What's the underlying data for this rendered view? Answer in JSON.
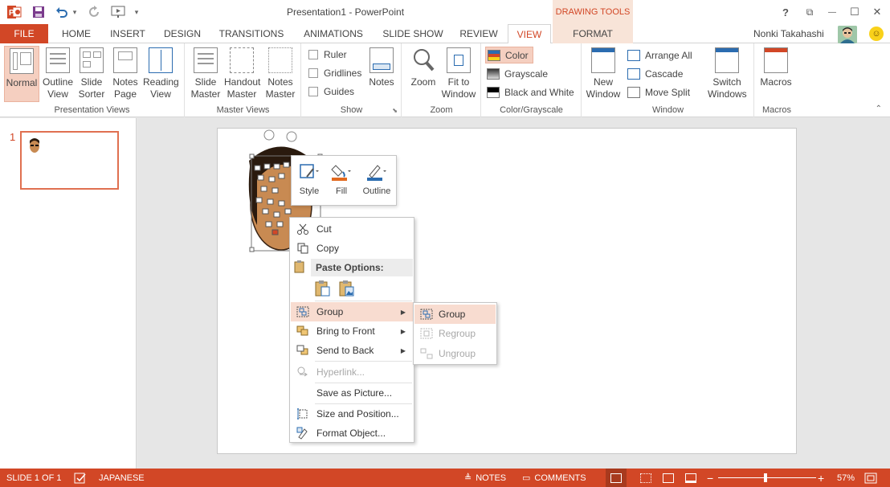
{
  "app": {
    "title": "Presentation1 - PowerPoint",
    "contextual_tab_group": "DRAWING TOOLS"
  },
  "window_controls": {
    "help": "?",
    "restore": "⧉",
    "minimize": "—",
    "maximize": "☐",
    "close": "✕"
  },
  "quick_access": {
    "undo_dropdown": "▾",
    "customize": "▾"
  },
  "tabs": {
    "file": "FILE",
    "home": "HOME",
    "insert": "INSERT",
    "design": "DESIGN",
    "transitions": "TRANSITIONS",
    "animations": "ANIMATIONS",
    "slideshow": "SLIDE SHOW",
    "review": "REVIEW",
    "view": "VIEW",
    "format": "FORMAT"
  },
  "user": {
    "name": "Nonki Takahashi"
  },
  "ribbon": {
    "presentation_views": {
      "label": "Presentation Views",
      "normal": "Normal",
      "outline_view": "Outline\nView",
      "slide_sorter": "Slide\nSorter",
      "notes_page": "Notes\nPage",
      "reading_view": "Reading\nView"
    },
    "master_views": {
      "label": "Master Views",
      "slide_master": "Slide\nMaster",
      "handout_master": "Handout\nMaster",
      "notes_master": "Notes\nMaster"
    },
    "show": {
      "label": "Show",
      "ruler": "Ruler",
      "gridlines": "Gridlines",
      "guides": "Guides",
      "notes": "Notes"
    },
    "zoom": {
      "label": "Zoom",
      "zoom": "Zoom",
      "fit_to_window": "Fit to\nWindow"
    },
    "color_grayscale": {
      "label": "Color/Grayscale",
      "color": "Color",
      "grayscale": "Grayscale",
      "black_and_white": "Black and White"
    },
    "window": {
      "label": "Window",
      "new_window": "New\nWindow",
      "arrange_all": "Arrange All",
      "cascade": "Cascade",
      "move_split": "Move Split",
      "switch_windows": "Switch\nWindows"
    },
    "macros": {
      "label": "Macros",
      "macros": "Macros"
    }
  },
  "thumbnails": {
    "slide_number": "1"
  },
  "mini_toolbar": {
    "style": "Style",
    "fill": "Fill",
    "outline": "Outline"
  },
  "context_menu": {
    "cut": "Cut",
    "copy": "Copy",
    "paste_options": "Paste Options:",
    "group": "Group",
    "bring_to_front": "Bring to Front",
    "send_to_back": "Send to Back",
    "hyperlink": "Hyperlink...",
    "save_as_picture": "Save as Picture...",
    "size_and_position": "Size and Position...",
    "format_object": "Format Object..."
  },
  "submenu": {
    "group": "Group",
    "regroup": "Regroup",
    "ungroup": "Ungroup"
  },
  "statusbar": {
    "slide_info": "SLIDE 1 OF 1",
    "language": "JAPANESE",
    "notes": "NOTES",
    "comments": "COMMENTS",
    "zoom_level": "57%",
    "zoom_minus": "−",
    "zoom_plus": "+"
  },
  "colors": {
    "accent": "#d24726",
    "highlight": "#f8dcd0",
    "contextual_tab": "#f8e4d8"
  }
}
